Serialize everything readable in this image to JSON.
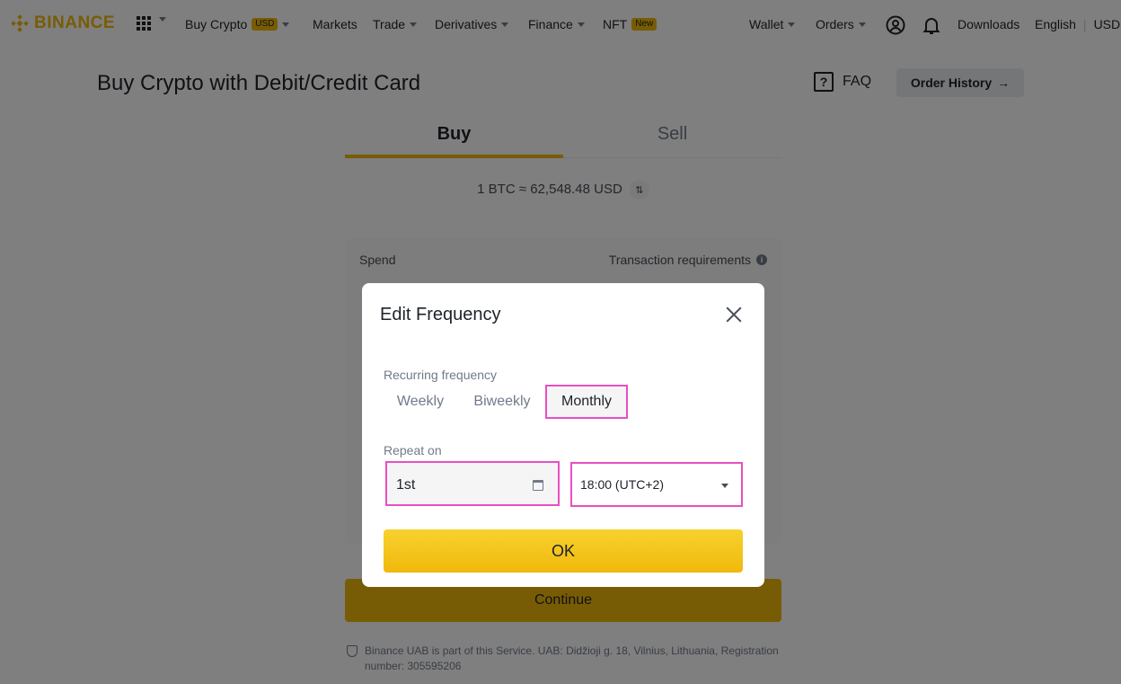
{
  "nav": {
    "logo_text": "BINANCE",
    "buy_crypto": "Buy Crypto",
    "buy_crypto_badge": "USD",
    "markets": "Markets",
    "trade": "Trade",
    "derivatives": "Derivatives",
    "finance": "Finance",
    "nft": "NFT",
    "nft_badge": "New",
    "wallet": "Wallet",
    "orders": "Orders",
    "downloads": "Downloads",
    "language": "English",
    "currency": "USD"
  },
  "page": {
    "title": "Buy Crypto with Debit/Credit Card",
    "faq": "FAQ",
    "order_history": "Order History",
    "tabs": [
      "Buy",
      "Sell"
    ],
    "rate": "1 BTC ≈ 62,548.48 USD",
    "spend_label": "Spend",
    "transaction_requirements": "Transaction requirements",
    "continue": "Continue",
    "footer_note": "Binance UAB is part of this Service. UAB: Didžioji g. 18, Vilnius, Lithuania, Registration number: 305595206"
  },
  "modal": {
    "title": "Edit Frequency",
    "recurring_label": "Recurring frequency",
    "frequency_options": [
      "Weekly",
      "Biweekly",
      "Monthly"
    ],
    "selected_frequency": "Monthly",
    "repeat_label": "Repeat on",
    "day_value": "1st",
    "time_value": "18:00 (UTC+2)",
    "ok": "OK"
  },
  "colors": {
    "brand": "#f0b90b",
    "highlight": "#e84fc2"
  }
}
